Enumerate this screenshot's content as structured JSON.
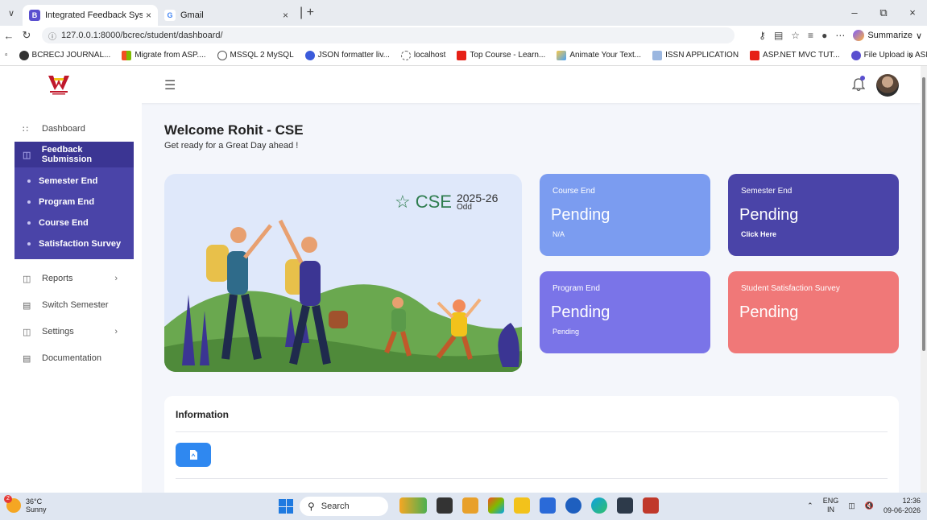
{
  "browser": {
    "tabs": [
      {
        "label": "Integrated Feedback System",
        "active": true
      },
      {
        "label": "Gmail",
        "active": false
      }
    ],
    "url": "127.0.0.1:8000/bcrec/student/dashboard/",
    "summarize_label": "Summarize",
    "bookmarks": [
      "BCRECJ JOURNAL...",
      "Migrate from ASP....",
      "MSSQL 2 MySQL",
      "JSON formatter liv...",
      "localhost",
      "Top Course - Learn...",
      "Animate Your Text...",
      "ISSN APPLICATION",
      "ASP.NET MVC TUT...",
      "File Upload in ASP...."
    ]
  },
  "sidebar": {
    "dashboard": "Dashboard",
    "feedback_submission": "Feedback Submission",
    "sub_items": [
      "Semester End",
      "Program End",
      "Course End",
      "Satisfaction Survey"
    ],
    "reports": "Reports",
    "switch_semester": "Switch Semester",
    "settings": "Settings",
    "documentation": "Documentation"
  },
  "main": {
    "welcome": "Welcome Rohit - CSE",
    "subtitle": "Get ready for a Great Day ahead !",
    "hero": {
      "dept": "CSE",
      "year": "2025-26",
      "term": "Odd"
    },
    "cards": [
      {
        "title": "Course End",
        "value": "Pending",
        "sub": "N/A",
        "color": "#7b9cf0"
      },
      {
        "title": "Semester End",
        "value": "Pending",
        "sub": "Click Here",
        "color": "#4a44a8"
      },
      {
        "title": "Program End",
        "value": "Pending",
        "sub": "Pending",
        "color": "#7a74e8"
      },
      {
        "title": "Student Satisfaction Survey",
        "value": "Pending",
        "sub": "",
        "color": "#f07878"
      }
    ],
    "info_title": "Information"
  },
  "taskbar": {
    "temp": "36°C",
    "weather": "Sunny",
    "badge": "2",
    "search": "Search",
    "lang1": "ENG",
    "lang2": "IN",
    "time": "12:36",
    "date": "09-06-2026"
  }
}
